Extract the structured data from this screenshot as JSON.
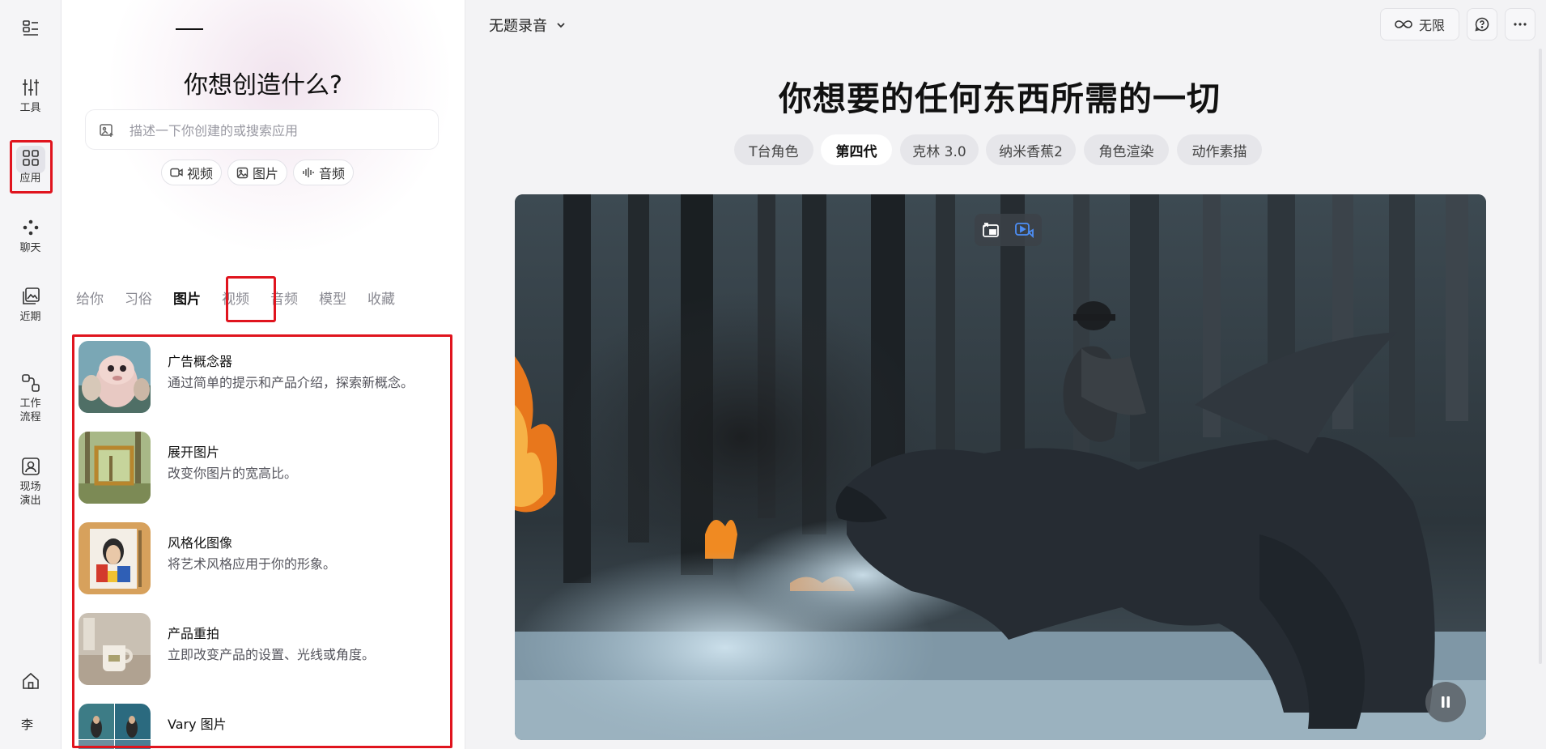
{
  "rail": {
    "items": [
      {
        "label": "",
        "icon": "layout-list-icon"
      },
      {
        "label": "工具",
        "icon": "sliders-icon"
      },
      {
        "label": "应用",
        "icon": "grid-apps-icon"
      },
      {
        "label": "聊天",
        "icon": "chat-nodes-icon"
      },
      {
        "label": "近期",
        "icon": "recent-images-icon"
      },
      {
        "label": "工作\n流程",
        "icon": "workflow-icon"
      },
      {
        "label": "现场\n演出",
        "icon": "live-icon"
      },
      {
        "label": "",
        "icon": "home-icon"
      }
    ],
    "avatar": "李"
  },
  "panel": {
    "title": "你想创造什么?",
    "search_placeholder": "描述一下你创建的或搜索应用",
    "chips": [
      {
        "label": "视频",
        "icon": "video-icon"
      },
      {
        "label": "图片",
        "icon": "image-icon"
      },
      {
        "label": "音频",
        "icon": "audio-icon"
      }
    ],
    "tabs": [
      "给你",
      "习俗",
      "图片",
      "视频",
      "音频",
      "模型",
      "收藏"
    ],
    "active_tab": "图片",
    "apps": [
      {
        "name": "广告概念器",
        "desc": "通过简单的提示和产品介绍，探索新概念。"
      },
      {
        "name": "展开图片",
        "desc": "改变你图片的宽高比。"
      },
      {
        "name": "风格化图像",
        "desc": "将艺术风格应用于你的形象。"
      },
      {
        "name": "产品重拍",
        "desc": "立即改变产品的设置、光线或角度。"
      },
      {
        "name": "Vary 图片",
        "desc": ""
      }
    ]
  },
  "main": {
    "doc_title": "无题录音",
    "unlimited_label": "无限",
    "hero": "你想要的任何东西所需的一切",
    "pills": [
      "T台角色",
      "第四代",
      "克林 3.0",
      "纳米香蕉2",
      "角色渲染",
      "动作素描"
    ],
    "active_pill": "第四代"
  },
  "colors": {
    "highlight_box": "#e0141e",
    "background": "#f3f3f5"
  }
}
